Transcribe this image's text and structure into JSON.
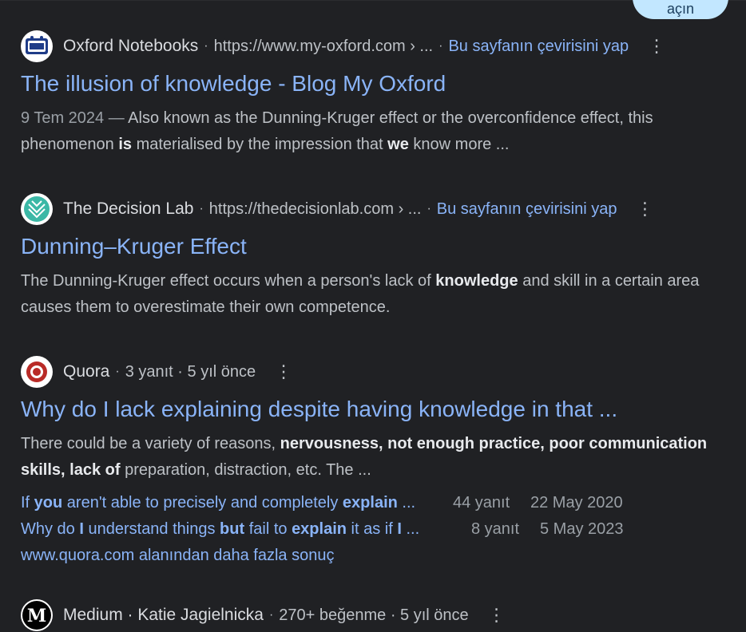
{
  "top_button": {
    "label": "açın"
  },
  "results": [
    {
      "site": "Oxford Notebooks",
      "url": "https://www.my-oxford.com › ...",
      "translate": "Bu sayfanın çevirisini yap",
      "title": "The illusion of knowledge - Blog My Oxford",
      "date": "9 Tem 2024 —",
      "snippet": [
        {
          "t": " Also known as the Dunning-Kruger effect or the overconfidence effect, this phenomenon "
        },
        {
          "t": "is",
          "b": true
        },
        {
          "t": " materialised by the impression that "
        },
        {
          "t": "we",
          "b": true
        },
        {
          "t": " know more ..."
        }
      ]
    },
    {
      "site": "The Decision Lab",
      "url": "https://thedecisionlab.com › ...",
      "translate": "Bu sayfanın çevirisini yap",
      "title": "Dunning–Kruger Effect",
      "snippet": [
        {
          "t": "The Dunning-Kruger effect occurs when a person's lack of "
        },
        {
          "t": "knowledge",
          "b": true
        },
        {
          "t": " and skill in a certain area causes them to overestimate their own competence."
        }
      ]
    },
    {
      "site": "Quora",
      "meta": "3 yanıt · 5 yıl önce",
      "title": "Why do I lack explaining despite having knowledge in that ...",
      "snippet": [
        {
          "t": "There could be a variety of reasons, "
        },
        {
          "t": "nervousness, not enough practice, poor communication skills, lack of",
          "b": true
        },
        {
          "t": " preparation, distraction, etc. The ..."
        }
      ],
      "subresults": [
        {
          "parts": [
            {
              "t": "If "
            },
            {
              "t": "you",
              "b": true
            },
            {
              "t": " aren't able to precisely and completely "
            },
            {
              "t": "explain",
              "b": true
            },
            {
              "t": " ..."
            }
          ],
          "count": "44 yanıt",
          "date": "22 May 2020"
        },
        {
          "parts": [
            {
              "t": "Why do "
            },
            {
              "t": "I",
              "b": true
            },
            {
              "t": " understand things "
            },
            {
              "t": "but",
              "b": true
            },
            {
              "t": " fail to "
            },
            {
              "t": "explain",
              "b": true
            },
            {
              "t": " it as if "
            },
            {
              "t": "I",
              "b": true
            },
            {
              "t": " ..."
            }
          ],
          "count": "8 yanıt",
          "date": "5 May 2023"
        }
      ],
      "more": "www.quora.com alanından daha fazla sonuç"
    },
    {
      "site": "Medium · Katie Jagielnicka",
      "meta": "270+ beğenme · 5 yıl önce"
    }
  ]
}
